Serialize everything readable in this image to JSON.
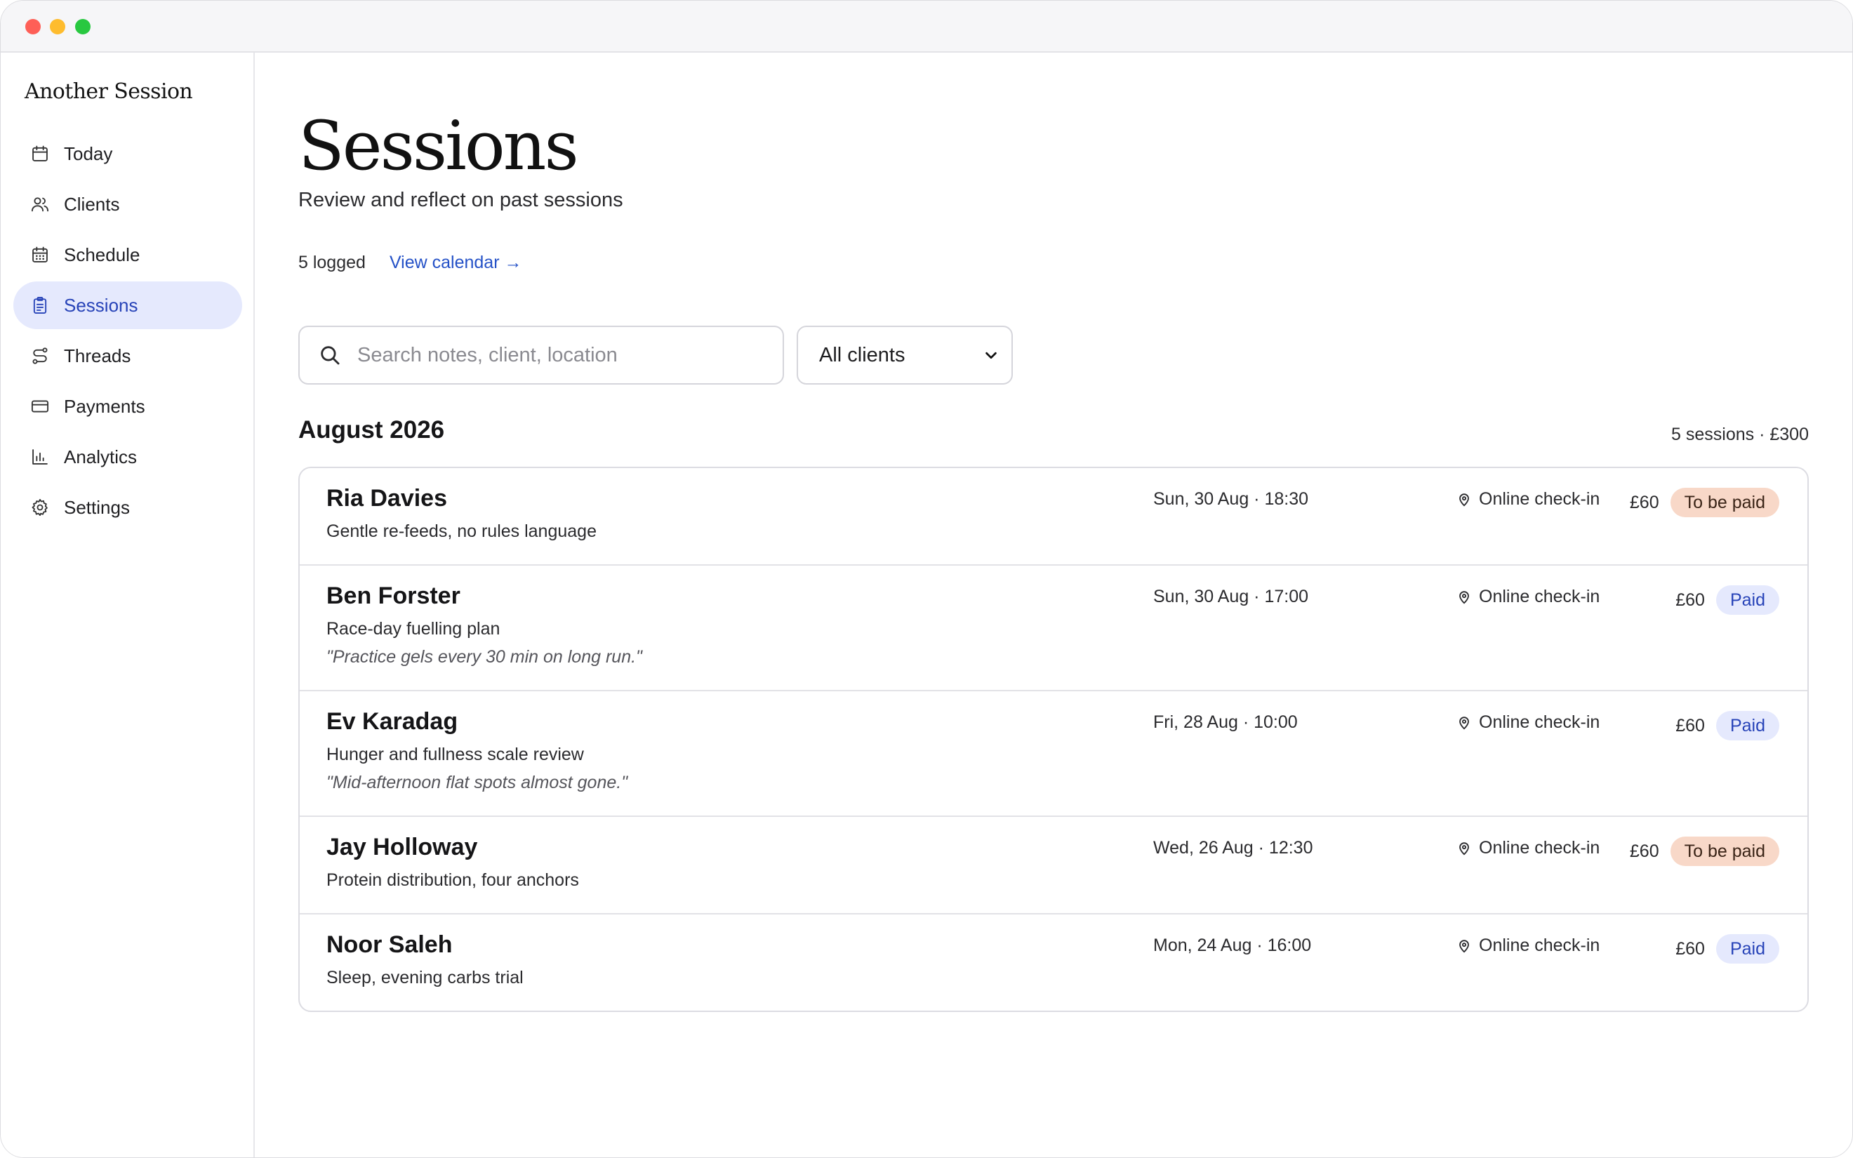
{
  "app": {
    "title": "Another Session"
  },
  "sidebar": {
    "items": [
      {
        "label": "Today",
        "icon": "calendar-icon",
        "active": false
      },
      {
        "label": "Clients",
        "icon": "users-icon",
        "active": false
      },
      {
        "label": "Schedule",
        "icon": "calendar-grid-icon",
        "active": false
      },
      {
        "label": "Sessions",
        "icon": "clipboard-icon",
        "active": true
      },
      {
        "label": "Threads",
        "icon": "route-icon",
        "active": false
      },
      {
        "label": "Payments",
        "icon": "credit-card-icon",
        "active": false
      },
      {
        "label": "Analytics",
        "icon": "bar-chart-icon",
        "active": false
      },
      {
        "label": "Settings",
        "icon": "gear-icon",
        "active": false
      }
    ]
  },
  "page": {
    "title": "Sessions",
    "subtitle": "Review and reflect on past sessions",
    "logged": "5 logged",
    "calendar_link": "View calendar →"
  },
  "filters": {
    "search_placeholder": "Search notes, client, location",
    "search_value": "",
    "client_select": "All clients"
  },
  "group": {
    "month": "August 2026",
    "summary": "5 sessions · £300"
  },
  "sessions": [
    {
      "client": "Ria Davies",
      "topic": "Gentle re-feeds, no rules language",
      "note": "",
      "when": "Sun, 30 Aug · 18:30",
      "where": "Online check-in",
      "price": "£60",
      "status": "To be paid"
    },
    {
      "client": "Ben Forster",
      "topic": "Race-day fuelling plan",
      "note": "\"Practice gels every 30 min on long run.\"",
      "when": "Sun, 30 Aug · 17:00",
      "where": "Online check-in",
      "price": "£60",
      "status": "Paid"
    },
    {
      "client": "Ev Karadag",
      "topic": "Hunger and fullness scale review",
      "note": "\"Mid-afternoon flat spots almost gone.\"",
      "when": "Fri, 28 Aug · 10:00",
      "where": "Online check-in",
      "price": "£60",
      "status": "Paid"
    },
    {
      "client": "Jay Holloway",
      "topic": "Protein distribution, four anchors",
      "note": "",
      "when": "Wed, 26 Aug · 12:30",
      "where": "Online check-in",
      "price": "£60",
      "status": "To be paid"
    },
    {
      "client": "Noor Saleh",
      "topic": "Sleep, evening carbs trial",
      "note": "",
      "when": "Mon, 24 Aug · 16:00",
      "where": "Online check-in",
      "price": "£60",
      "status": "Paid"
    }
  ],
  "colors": {
    "accent": "#2451c7",
    "active_bg": "#e5e9fd",
    "unpaid_bg": "#f8d8c8",
    "paid_bg": "#e5e9fd"
  }
}
